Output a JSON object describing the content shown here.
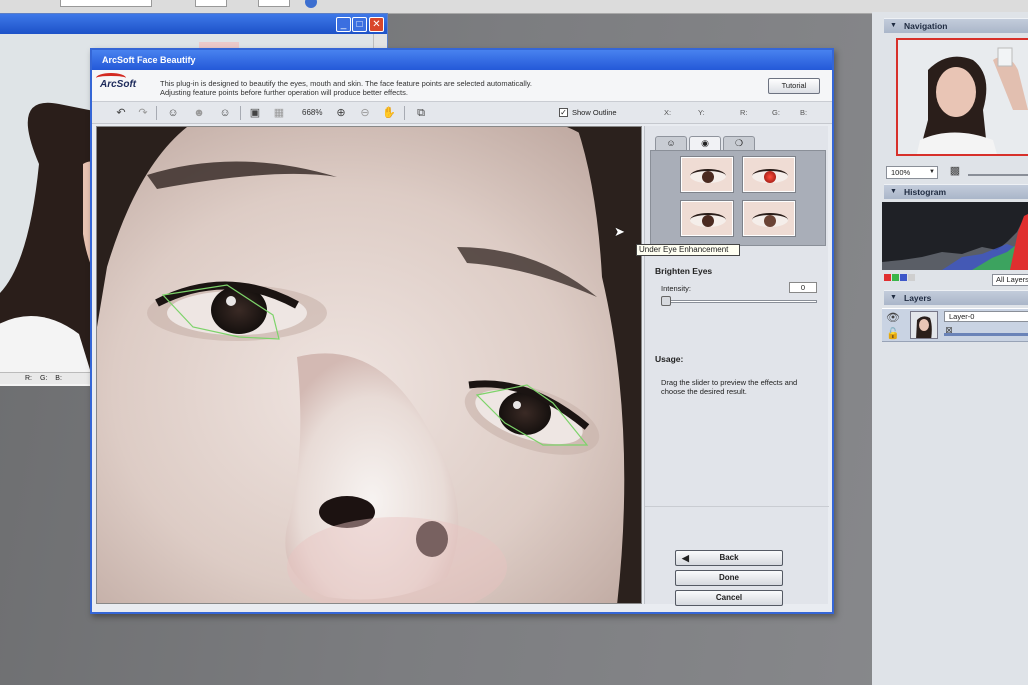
{
  "top_strip": {
    "fields": [
      "",
      "",
      ""
    ]
  },
  "background_window": {
    "title": "",
    "status_r": "R:",
    "status_g": "G:",
    "status_b": "B:"
  },
  "dialog": {
    "title": "ArcSoft Face Beautify",
    "logo": "ArcSoft",
    "header_line1": "This plug-in is designed to beautify the eyes, mouth and skin. The face feature points are selected automatically.",
    "header_line2": "Adjusting feature points before further operation will produce better effects.",
    "tutorial_label": "Tutorial",
    "toolbar": {
      "zoom_level": "668%",
      "show_outline_label": "Show Outline",
      "show_outline_checked": true,
      "coord_x": "X:",
      "coord_y": "Y:",
      "coord_r": "R:",
      "coord_g": "G:",
      "coord_b": "B:",
      "icons": [
        "undo-icon",
        "redo-icon",
        "face-point-icon",
        "face-point-add-icon",
        "face-point-remove-icon",
        "fit-icon",
        "actual-size-icon",
        "zoom-in-icon",
        "zoom-out-icon",
        "hand-icon",
        "preview-icon"
      ]
    },
    "tabs": [
      "face-tab",
      "eye-tab",
      "mouth-tab"
    ],
    "active_tab": 1,
    "tooltip": "Under Eye Enhancement",
    "brighten_title": "Brighten Eyes",
    "intensity_label": "Intensity:",
    "intensity_value": "0",
    "intensity_fraction": 0,
    "usage_title": "Usage:",
    "usage_line1": "Drag the slider to preview the effects and",
    "usage_line2": "choose the desired result.",
    "back_label": "Back",
    "done_label": "Done",
    "cancel_label": "Cancel",
    "outline_color": "#7dd36a"
  },
  "palettes": {
    "navigation_title": "Navigation",
    "zoom_value": "100%",
    "histogram_title": "Histogram",
    "histogram_channel": "All Layers",
    "layers_title": "Layers",
    "layer_name": "Layer-0"
  }
}
